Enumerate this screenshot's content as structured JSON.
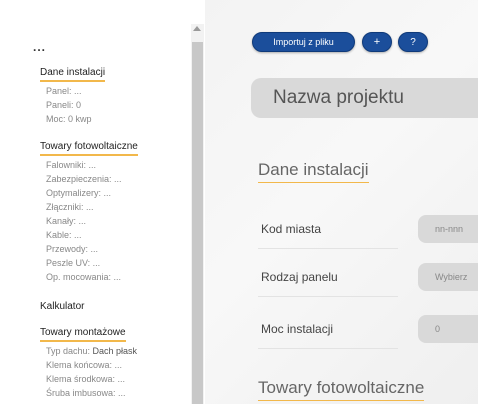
{
  "sidebar": {
    "menu_dots": "...",
    "sections": [
      {
        "title": "Dane instalacji",
        "items": [
          "Panel: ...",
          "Paneli: 0",
          "Moc: 0 kwp"
        ]
      },
      {
        "title": "Towary fotowoltaiczne",
        "items": [
          "Falowniki: ...",
          "Zabezpieczenia: ...",
          "Optymalizery: ...",
          "Złączniki: ...",
          "Kanały: ...",
          "Kable: ...",
          "Przewody: ...",
          "Peszle UV: ...",
          "Op. mocowania: ..."
        ]
      },
      {
        "title": "Kalkulator",
        "items": []
      },
      {
        "title": "Towary montażowe",
        "items": [
          "Typ dachu: ",
          "Klema końcowa: ...",
          "Klema środkowa: ...",
          "Śruba imbusowa: ..."
        ],
        "roof_type_value": "Dach płask"
      }
    ]
  },
  "toolbar": {
    "import_label": "Importuj z pliku",
    "add_label": "+",
    "help_label": "?"
  },
  "project": {
    "name_placeholder": "Nazwa projektu"
  },
  "main": {
    "section1_title": "Dane instalacji",
    "fields": [
      {
        "label": "Kod miasta",
        "value": "nn-nnn"
      },
      {
        "label": "Rodzaj panelu",
        "value": "Wybierz"
      },
      {
        "label": "Moc instalacji",
        "value": "0"
      }
    ],
    "section2_title": "Towary fotowoltaiczne"
  },
  "colors": {
    "accent_underline": "#f2b84b",
    "button_blue": "#1b4e9b",
    "input_gray": "#d9d9d9"
  }
}
